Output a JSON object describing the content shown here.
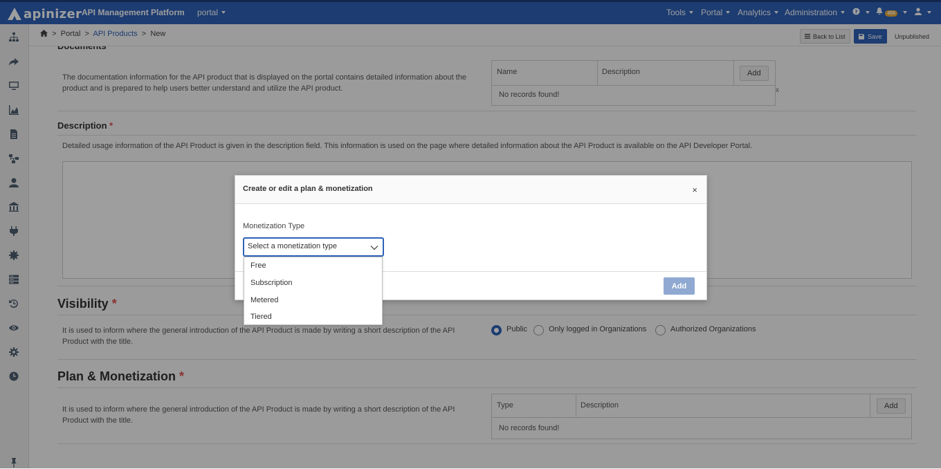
{
  "topbar": {
    "logo_text": "apinizer",
    "platform_title": "API Management Platform",
    "project": "portal",
    "menus": [
      "Tools",
      "Portal",
      "Analytics",
      "Administration"
    ],
    "help_icon": "question-circle-icon",
    "notification_icon": "bell-icon",
    "notification_count": "456",
    "user_icon": "user-icon"
  },
  "sidebar": {
    "icons": [
      "sitemap-icon",
      "share-arrow-icon",
      "monitor-icon",
      "area-chart-icon",
      "file-icon",
      "flow-icon",
      "user-icon",
      "building-icon",
      "plug-icon",
      "gear-burst-icon",
      "server-icon",
      "history-icon",
      "eye-icon",
      "cog-icon",
      "clock-icon",
      "pin-icon"
    ]
  },
  "breadcrumb": {
    "home_icon": "home-icon",
    "items": [
      "Portal",
      "API Products",
      "New"
    ]
  },
  "toolbar": {
    "back_label": "Back to List",
    "save_label": "Save",
    "status": "Unpublished"
  },
  "documents": {
    "title": "Documents",
    "text": "The documentation information for the API product that is displayed on the portal contains detailed information about the product and is prepared to help users better understand and utilize the API product.",
    "columns": [
      "Name",
      "Description"
    ],
    "add_label": "Add",
    "empty": "No records found!"
  },
  "description": {
    "title": "Description",
    "text": "Detailed usage information of the API Product is given in the description field. This information is used on the page where detailed information about the API Product is available on the API Developer Portal."
  },
  "visibility": {
    "title": "Visibility",
    "text": "It is used to inform where the general introduction of the API Product is made by writing a short description of the API Product with the title.",
    "options": [
      "Public",
      "Only logged in Organizations",
      "Authorized Organizations"
    ],
    "selected": "Public"
  },
  "plan": {
    "title": "Plan & Monetization",
    "text": "It is used to inform where the general introduction of the API Product is made by writing a short description of the API Product with the title.",
    "columns": [
      "Type",
      "Description"
    ],
    "add_label": "Add",
    "empty": "No records found!"
  },
  "modal": {
    "title": "Create or edit a plan & monetization",
    "close": "×",
    "field_label": "Monetization Type",
    "select_placeholder": "Select a monetization type",
    "options": [
      "Free",
      "Subscription",
      "Metered",
      "Tiered"
    ],
    "add_label": "Add"
  }
}
